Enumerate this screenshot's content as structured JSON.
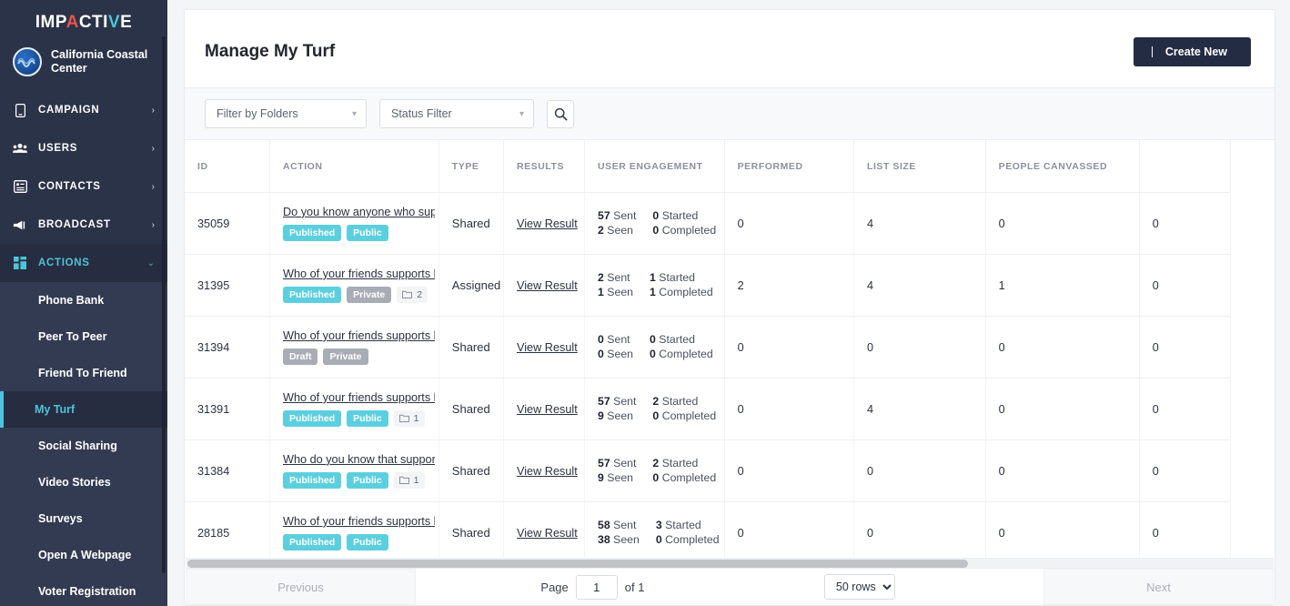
{
  "brand": {
    "logo_part1": "IMP",
    "logo_a": "A",
    "logo_part2": "CTI",
    "logo_v": "V",
    "logo_part3": "E",
    "org_name": "California Coastal Center",
    "accent_teal": "#4ec3d9",
    "accent_red": "#e8554e",
    "sidebar_bg": "#2b3348"
  },
  "sidebar": {
    "items": [
      {
        "label": "CAMPAIGN",
        "icon": "mobile-icon",
        "chevron": "›",
        "expanded": false
      },
      {
        "label": "USERS",
        "icon": "users-icon",
        "chevron": "›",
        "expanded": false
      },
      {
        "label": "CONTACTS",
        "icon": "contacts-icon",
        "chevron": "›",
        "expanded": false
      },
      {
        "label": "BROADCAST",
        "icon": "megaphone-icon",
        "chevron": "›",
        "expanded": false
      },
      {
        "label": "ACTIONS",
        "icon": "grid-icon",
        "chevron": "⌄",
        "expanded": true
      }
    ],
    "subitems": [
      {
        "label": "Phone Bank",
        "active": false
      },
      {
        "label": "Peer To Peer",
        "active": false
      },
      {
        "label": "Friend To Friend",
        "active": false
      },
      {
        "label": "My Turf",
        "active": true
      },
      {
        "label": "Social Sharing",
        "active": false
      },
      {
        "label": "Video Stories",
        "active": false
      },
      {
        "label": "Surveys",
        "active": false
      },
      {
        "label": "Open A Webpage",
        "active": false
      },
      {
        "label": "Voter Registration",
        "active": false
      }
    ]
  },
  "header": {
    "title": "Manage My Turf",
    "create_label": "Create New"
  },
  "filters": {
    "folders_label": "Filter by Folders",
    "status_label": "Status Filter",
    "search_icon": "search-icon"
  },
  "table": {
    "columns": [
      "ID",
      "ACTION",
      "TYPE",
      "RESULTS",
      "USER ENGAGEMENT",
      "PERFORMED",
      "LIST SIZE",
      "PEOPLE CANVASSED",
      ""
    ],
    "view_result_label": "View Result",
    "rows": [
      {
        "id": "35059",
        "action": "Do you know anyone who supports",
        "badges": [
          {
            "text": "Published",
            "style": "teal"
          },
          {
            "text": "Public",
            "style": "teal"
          }
        ],
        "folder_count": null,
        "type": "Shared",
        "sent": "57",
        "sent_label": "Sent",
        "seen": "2",
        "seen_label": "Seen",
        "started": "0",
        "started_label": "Started",
        "completed": "0",
        "completed_label": "Completed",
        "performed": "0",
        "list_size": "4",
        "people_canvassed": "0",
        "extra": "0"
      },
      {
        "id": "31395",
        "action": "Who of your friends supports keep",
        "badges": [
          {
            "text": "Published",
            "style": "teal"
          },
          {
            "text": "Private",
            "style": "gray"
          }
        ],
        "folder_count": "2",
        "type": "Assigned",
        "sent": "2",
        "sent_label": "Sent",
        "seen": "1",
        "seen_label": "Seen",
        "started": "1",
        "started_label": "Started",
        "completed": "1",
        "completed_label": "Completed",
        "performed": "2",
        "list_size": "4",
        "people_canvassed": "1",
        "extra": "0"
      },
      {
        "id": "31394",
        "action": "Who of your friends supports keep",
        "badges": [
          {
            "text": "Draft",
            "style": "gray"
          },
          {
            "text": "Private",
            "style": "gray"
          }
        ],
        "folder_count": null,
        "type": "Shared",
        "sent": "0",
        "sent_label": "Sent",
        "seen": "0",
        "seen_label": "Seen",
        "started": "0",
        "started_label": "Started",
        "completed": "0",
        "completed_label": "Completed",
        "performed": "0",
        "list_size": "0",
        "people_canvassed": "0",
        "extra": "0"
      },
      {
        "id": "31391",
        "action": "Who of your friends supports keep",
        "badges": [
          {
            "text": "Published",
            "style": "teal"
          },
          {
            "text": "Public",
            "style": "teal"
          }
        ],
        "folder_count": "1",
        "type": "Shared",
        "sent": "57",
        "sent_label": "Sent",
        "seen": "9",
        "seen_label": "Seen",
        "started": "2",
        "started_label": "Started",
        "completed": "0",
        "completed_label": "Completed",
        "performed": "0",
        "list_size": "4",
        "people_canvassed": "0",
        "extra": "0"
      },
      {
        "id": "31384",
        "action": "Who do you know that supports ke",
        "badges": [
          {
            "text": "Published",
            "style": "teal"
          },
          {
            "text": "Public",
            "style": "teal"
          }
        ],
        "folder_count": "1",
        "type": "Shared",
        "sent": "57",
        "sent_label": "Sent",
        "seen": "9",
        "seen_label": "Seen",
        "started": "2",
        "started_label": "Started",
        "completed": "0",
        "completed_label": "Completed",
        "performed": "0",
        "list_size": "0",
        "people_canvassed": "0",
        "extra": "0"
      },
      {
        "id": "28185",
        "action": "Who of your friends supports keep",
        "badges": [
          {
            "text": "Published",
            "style": "teal"
          },
          {
            "text": "Public",
            "style": "teal"
          }
        ],
        "folder_count": null,
        "type": "Shared",
        "sent": "58",
        "sent_label": "Sent",
        "seen": "38",
        "seen_label": "Seen",
        "started": "3",
        "started_label": "Started",
        "completed": "0",
        "completed_label": "Completed",
        "performed": "0",
        "list_size": "0",
        "people_canvassed": "0",
        "extra": "0"
      }
    ]
  },
  "pagination": {
    "previous_label": "Previous",
    "next_label": "Next",
    "page_label": "Page",
    "page_value": "1",
    "of_label": "of 1",
    "rows_selected": "50 rows",
    "rows_options": [
      "50 rows"
    ]
  }
}
